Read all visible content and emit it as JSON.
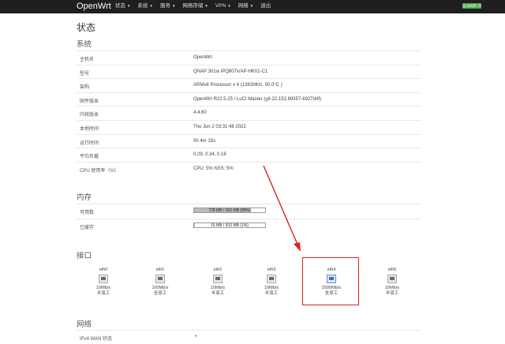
{
  "nav": {
    "brand": "OpenWrt",
    "menu": [
      {
        "label": "状态"
      },
      {
        "label": "系统"
      },
      {
        "label": "服务"
      },
      {
        "label": "网络存储"
      },
      {
        "label": "VPN"
      },
      {
        "label": "网络"
      },
      {
        "label": "退出"
      }
    ],
    "badge": "自动刷新 开"
  },
  "page_title": "状态",
  "system": {
    "title": "系统",
    "rows": [
      {
        "key": "主机名",
        "value": "OpenWrt"
      },
      {
        "key": "型号",
        "value": "QNAP 301w IPQ807x/AP-HK01-C1"
      },
      {
        "key": "架构",
        "value": "ARMv8 Processor x 4 (1382MHz, 50.0°C )"
      },
      {
        "key": "固件版本",
        "value": "OpenWrt R22.5.25 / LuCI Master (git-22.152.69357-6927d4f)"
      },
      {
        "key": "内核版本",
        "value": "4.4.60"
      },
      {
        "key": "本地时间",
        "value": "Thu Jun 2 03:31:48 2022"
      },
      {
        "key": "运行时间",
        "value": "0h 4m 15s"
      },
      {
        "key": "平均负载",
        "value": "0.29, 0.34, 0.16"
      },
      {
        "key": "CPU 使用率（%）",
        "value": "CPU: 5% NSS: 5%"
      }
    ]
  },
  "memory": {
    "title": "内存",
    "rows": [
      {
        "key": "可用数",
        "bar_label": "728 MB / 910 MB (80%)",
        "fraction": 0.8
      },
      {
        "key": "已缓存",
        "bar_label": "15 MB / 910 MB (1%)",
        "fraction": 0.01
      }
    ]
  },
  "interfaces": {
    "title": "接口",
    "ports": [
      {
        "name": "eth0",
        "speed": "10Mb/s",
        "duplex": "半双工",
        "active": false
      },
      {
        "name": "eth1",
        "speed": "100Mb/s",
        "duplex": "全双工",
        "active": false
      },
      {
        "name": "eth2",
        "speed": "10Mb/s",
        "duplex": "半双工",
        "active": false
      },
      {
        "name": "eth3",
        "speed": "10Mb/s",
        "duplex": "半双工",
        "active": false
      },
      {
        "name": "eth4",
        "speed": "2500Mb/s",
        "duplex": "全双工",
        "active": true
      },
      {
        "name": "eth5",
        "speed": "10Mb/s",
        "duplex": "半双工",
        "active": false
      }
    ]
  },
  "network": {
    "title": "网络",
    "rows": [
      {
        "key": "IPv4 WAN 状态"
      }
    ]
  },
  "colors": {
    "annotation": "#e02020",
    "badge": "#46a546",
    "navbar": "#1f1f1f"
  }
}
